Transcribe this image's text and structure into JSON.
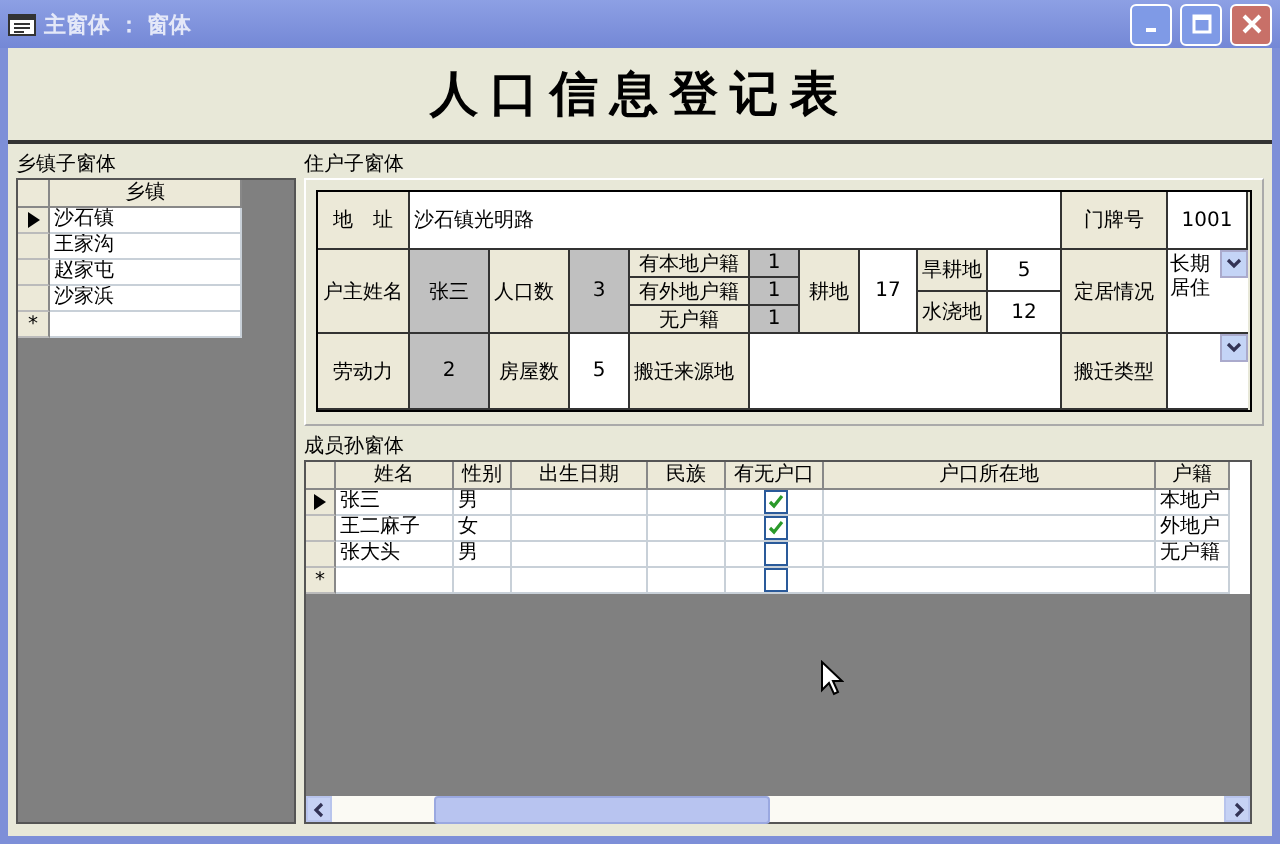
{
  "window": {
    "title": "主窗体 ： 窗体"
  },
  "header": {
    "title": "人口信息登记表"
  },
  "township_subform": {
    "label": "乡镇子窗体",
    "column": "乡镇",
    "new_row_marker": "*",
    "rows": [
      {
        "name": "沙石镇",
        "selected": true
      },
      {
        "name": "王家沟",
        "selected": false
      },
      {
        "name": "赵家屯",
        "selected": false
      },
      {
        "name": "沙家浜",
        "selected": false
      }
    ]
  },
  "household_subform": {
    "label": "住户子窗体",
    "address_label": "地　址",
    "address": "沙石镇光明路",
    "door_no_label": "门牌号",
    "door_no": "1001",
    "head_label": "户主姓名",
    "head": "张三",
    "population_label": "人口数",
    "population": "3",
    "registrations": [
      {
        "label": "有本地户籍",
        "count": "1"
      },
      {
        "label": "有外地户籍",
        "count": "1"
      },
      {
        "label": "无户籍",
        "count": "1"
      }
    ],
    "farmland_label": "耕地",
    "farmland": "17",
    "land_types": [
      {
        "label": "旱耕地",
        "value": "5"
      },
      {
        "label": "水浇地",
        "value": "12"
      }
    ],
    "residence_label": "定居情况",
    "residence": "长期居住",
    "labor_label": "劳动力",
    "labor": "2",
    "houses_label": "房屋数",
    "houses": "5",
    "origin_label": "搬迁来源地",
    "relocation_type_label": "搬迁类型"
  },
  "members_subform": {
    "label": "成员孙窗体",
    "columns": [
      "姓名",
      "性别",
      "出生日期",
      "民族",
      "有无户口",
      "户口所在地",
      "户籍"
    ],
    "new_row_marker": "*",
    "new_row": {
      "has_hukou": false
    },
    "rows": [
      {
        "name": "张三",
        "sex": "男",
        "has_hukou": true,
        "registry": "本地户",
        "selected": true
      },
      {
        "name": "王二麻子",
        "sex": "女",
        "has_hukou": true,
        "registry": "外地户",
        "selected": false
      },
      {
        "name": "张大头",
        "sex": "男",
        "has_hukou": false,
        "registry": "无户籍",
        "selected": false
      }
    ]
  }
}
